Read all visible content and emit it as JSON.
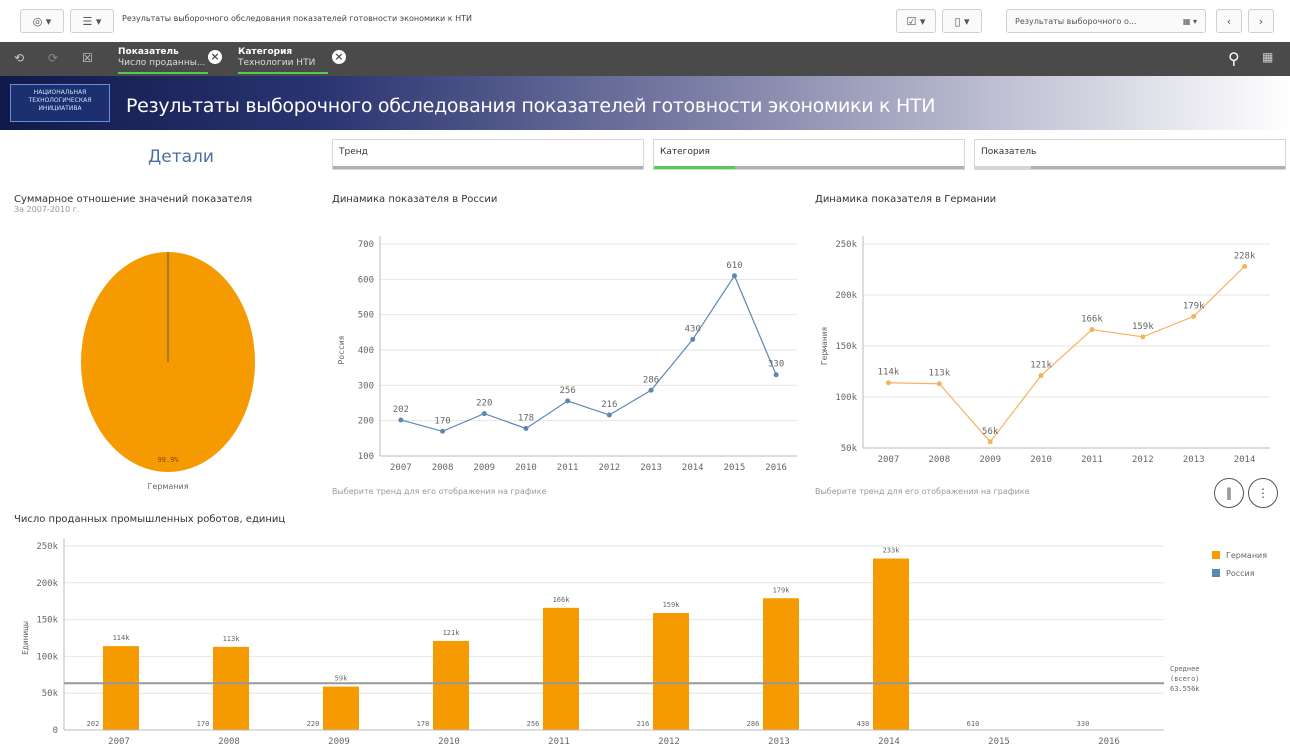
{
  "toolbar": {
    "sheet_title": "Результаты выборочного обследования показателей готовности экономики к НТИ",
    "sheet_selector": "Результаты выборочного о..."
  },
  "selections": [
    {
      "field": "Показатель",
      "value": "Число проданны..."
    },
    {
      "field": "Категория",
      "value": "Технологии НТИ"
    }
  ],
  "header": {
    "logo_text": "НАЦИОНАЛЬНАЯ ТЕХНОЛОГИЧЕСКАЯ ИНИЦИАТИВА",
    "title": "Результаты выборочного обследования показателей готовности экономики к НТИ"
  },
  "details_label": "Детали",
  "filters": [
    {
      "label": "Тренд",
      "accent": "#b0b0b0"
    },
    {
      "label": "Категория",
      "accent": "#52cc52"
    },
    {
      "label": "Показатель",
      "accent": "#b0b0b0"
    }
  ],
  "colors": {
    "germany": "#f59a00",
    "russia": "#5b86b8"
  },
  "pie": {
    "title": "Суммарное отношение значений показателя",
    "subtitle": "За 2007-2010 г.",
    "slice_label": "99.9%",
    "legend_label": "Германия"
  },
  "hint_text": "Выберите тренд для его отображения на графике",
  "chart_data": [
    {
      "type": "line",
      "title": "Динамика показателя в России",
      "ylabel": "Россия",
      "x": [
        "2007",
        "2008",
        "2009",
        "2010",
        "2011",
        "2012",
        "2013",
        "2014",
        "2015",
        "2016"
      ],
      "values": [
        202,
        170,
        220,
        178,
        256,
        216,
        286,
        430,
        610,
        330
      ],
      "value_labels": [
        "202",
        "170",
        "220",
        "178",
        "256",
        "216",
        "286",
        "430",
        "610",
        "330"
      ],
      "yticks": [
        "100",
        "200",
        "300",
        "400",
        "500",
        "600",
        "700"
      ],
      "ylim": [
        100,
        700
      ],
      "color": "#5b86b8"
    },
    {
      "type": "line",
      "title": "Динамика показателя в Германии",
      "ylabel": "Германия",
      "x": [
        "2007",
        "2008",
        "2009",
        "2010",
        "2011",
        "2012",
        "2013",
        "2014"
      ],
      "values": [
        114000,
        113000,
        56000,
        121000,
        166000,
        159000,
        179000,
        228000
      ],
      "value_labels": [
        "114k",
        "113k",
        "56k",
        "121k",
        "166k",
        "159k",
        "179k",
        "228k"
      ],
      "yticks": [
        "50k",
        "100k",
        "150k",
        "200k",
        "250k"
      ],
      "ylim": [
        50000,
        250000
      ],
      "color": "#f5b35c"
    },
    {
      "type": "bar",
      "title": "Число проданных промышленных роботов, единиц",
      "ylabel": "Единицы",
      "categories": [
        "2007",
        "2008",
        "2009",
        "2010",
        "2011",
        "2012",
        "2013",
        "2014",
        "2015",
        "2016"
      ],
      "series": [
        {
          "name": "Германия",
          "values": [
            114000,
            113000,
            59000,
            121000,
            166000,
            159000,
            179000,
            233000,
            0,
            0
          ],
          "labels": [
            "114k",
            "113k",
            "59k",
            "121k",
            "166k",
            "159k",
            "179k",
            "233k",
            "",
            ""
          ]
        },
        {
          "name": "Россия",
          "values": [
            202,
            170,
            220,
            178,
            256,
            216,
            286,
            430,
            610,
            330
          ],
          "labels": [
            "202",
            "170",
            "220",
            "178",
            "256",
            "216",
            "286",
            "430",
            "610",
            "330"
          ]
        }
      ],
      "yticks": [
        "0",
        "50k",
        "100k",
        "150k",
        "200k",
        "250k"
      ],
      "ylim": [
        0,
        250000
      ],
      "reference_line": {
        "value": 63556,
        "label": "Среднее (всего) 63.556k"
      }
    }
  ]
}
